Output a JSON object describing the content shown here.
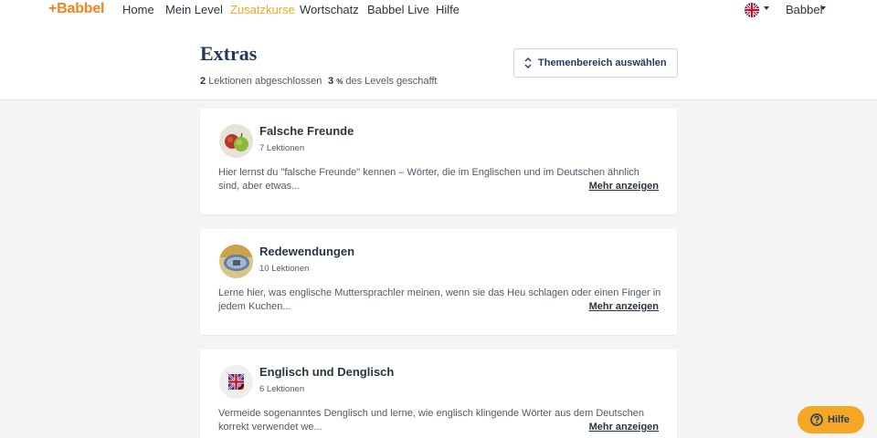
{
  "nav": {
    "logo": "+Babbel",
    "items": [
      "Home",
      "Mein Level",
      "Zusatzkurse",
      "Wortschatz",
      "Babbel Live",
      "Hilfe"
    ],
    "active_index": 2,
    "user_label": "Babbel",
    "language_flag": "uk-flag-icon"
  },
  "header": {
    "title": "Extras",
    "lessons_done_count": "2",
    "lessons_done_label": "Lektionen abgeschlossen",
    "level_percent": "3",
    "level_percent_unit": "%",
    "level_label": "des Levels geschafft",
    "theme_button_label": "Themenbereich auswählen"
  },
  "cards": [
    {
      "title": "Falsche Freunde",
      "count": "7 Lektionen",
      "description": "Hier lernst du \"falsche Freunde\" kennen – Wörter, die im Englischen und im Deutschen ähnlich sind, aber etwas...",
      "more_label": "Mehr anzeigen",
      "icon": "apples-icon"
    },
    {
      "title": "Redewendungen",
      "count": "10 Lektionen",
      "description": "Lerne hier, was englische Muttersprachler meinen, wenn sie das Heu schlagen oder einen Finger in jedem Kuchen...",
      "more_label": "Mehr anzeigen",
      "icon": "mirror-icon"
    },
    {
      "title": "Englisch und Denglisch",
      "count": "6 Lektionen",
      "description": "Vermeide sogenanntes Denglisch und lerne, wie englisch klingende Wörter aus dem Deutschen korrekt verwendet we...",
      "more_label": "Mehr anzeigen",
      "icon": "uk-de-flag-icon"
    }
  ],
  "help_button": {
    "label": "Hilfe"
  },
  "colors": {
    "brand_orange": "#f5811f",
    "active_nav": "#f5a623",
    "help_button_bg": "#f5a623",
    "title_navy": "#1f3a5f"
  }
}
